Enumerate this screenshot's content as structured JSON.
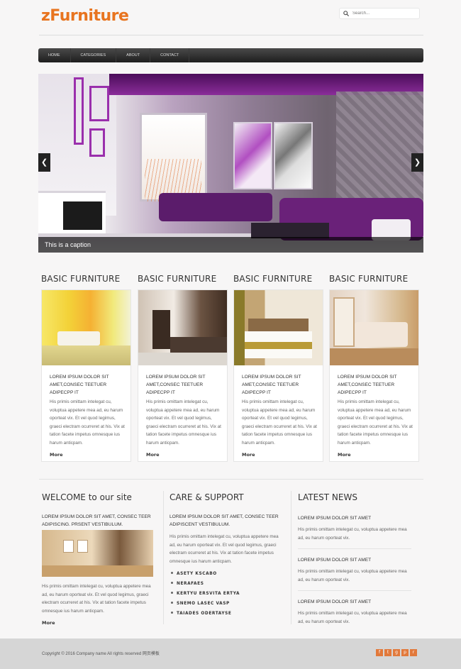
{
  "brand": {
    "logo": "zFurniture",
    "logo_color": "#e8741f"
  },
  "search": {
    "placeholder": "Search..."
  },
  "nav": [
    "HOME",
    "CATEGORIES",
    "ABOUT",
    "CONTACT"
  ],
  "slider": {
    "caption": "This is a caption",
    "prev_icon": "chevron-left-icon",
    "next_icon": "chevron-right-icon"
  },
  "features": [
    {
      "title": "BASIC FURNITURE",
      "heading": "LOREM IPSUM DOLOR SIT AMET,CONSEC TEETUER ADIPECPP IT",
      "text": "His primis omittam intelegat cu, voluptua appetere mea ad, eu harum oporteat vix. Et vel quod legimus, graeci electram ocurreret at his. Vix at tation facete impetus omnesque ius harum anticpam.",
      "more": "More"
    },
    {
      "title": "BASIC FURNITURE",
      "heading": "LOREM IPSUM DOLOR SIT AMET,CONSEC TEETUER ADIPECPP IT",
      "text": "His primis omittam intelegat cu, voluptua appetere mea ad, eu harum oporteat vix. Et vel quod legimus, graeci electram ocurreret at his. Vix at tation facete impetus omnesque ius harum anticpam.",
      "more": "More"
    },
    {
      "title": "BASIC FURNITURE",
      "heading": "LOREM IPSUM DOLOR SIT AMET,CONSEC TEETUER ADIPECPP IT",
      "text": "His primis omittam intelegat cu, voluptua appetere mea ad, eu harum oporteat vix. Et vel quod legimus, graeci electram ocurreret at his. Vix at tation facete impetus omnesque ius harum anticpam.",
      "more": "More"
    },
    {
      "title": "BASIC FURNITURE",
      "heading": "LOREM IPSUM DOLOR SIT AMET,CONSEC TEETUER ADIPECPP IT",
      "text": "His primis omittam intelegat cu, voluptua appetere mea ad, eu harum oporteat vix. Et vel quod legimus, graeci electram ocurreret at his. Vix at tation facete impetus omnesque ius harum anticpam.",
      "more": "More"
    }
  ],
  "welcome": {
    "title": "WELCOME to our site",
    "heading": "LOREM IPSUM DOLOR SIT AMET, CONSEC TEER ADIPISCING. PRSENT VESTIBULUM.",
    "text": "His primis omittam intelegat cu, voluptua appetere mea ad, eu harum oporteat vix. Et vel quod legimus, graeci electram ocurreret at his. Vix at tation facete impetus omnesque ius harum anticpam.",
    "more": "More"
  },
  "care": {
    "title": "CARE & SUPPORT",
    "heading": "LOREM IPSUM DOLOR SIT AMET, CONSEC TEER ADIPISCENT VESTIBULUM.",
    "text": "His primis omittam intelegat cu, voluptua appetere mea ad, eu harum oporteat vix. Et vel quod legimus, graeci electram ocurreret at his. Vix at tation facete impetus omnesque ius harum anticpam.",
    "links": [
      "ASETY KSCABO",
      "NERAFAES",
      "KERTYU ERSVITA ERTYA",
      "SNEMO LASEC VASP",
      "TAIADES ODERTAYSE"
    ]
  },
  "news": {
    "title": "LATEST NEWS",
    "items": [
      {
        "heading": "LOREM IPSUM DOLOR SIT AMET",
        "text": "His primis omittam intelegat cu, voluptua appetere mea ad, eu harum oporteat vix."
      },
      {
        "heading": "LOREM IPSUM DOLOR SIT AMET",
        "text": "His primis omittam intelegat cu, voluptua appetere mea ad, eu harum oporteat vix."
      },
      {
        "heading": "LOREM IPSUM DOLOR SIT AMET",
        "text": "His primis omittam intelegat cu, voluptua appetere mea ad, eu harum oporteat vix."
      }
    ]
  },
  "footer": {
    "copyright": "Copyright © 2016 Company name All rights reserved 网页模板",
    "social": [
      {
        "glyph": "f",
        "icon": "facebook-icon"
      },
      {
        "glyph": "t",
        "icon": "twitter-icon"
      },
      {
        "glyph": "g",
        "icon": "google-plus-icon"
      },
      {
        "glyph": "p",
        "icon": "pinterest-icon"
      },
      {
        "glyph": "r",
        "icon": "rss-icon"
      }
    ]
  }
}
